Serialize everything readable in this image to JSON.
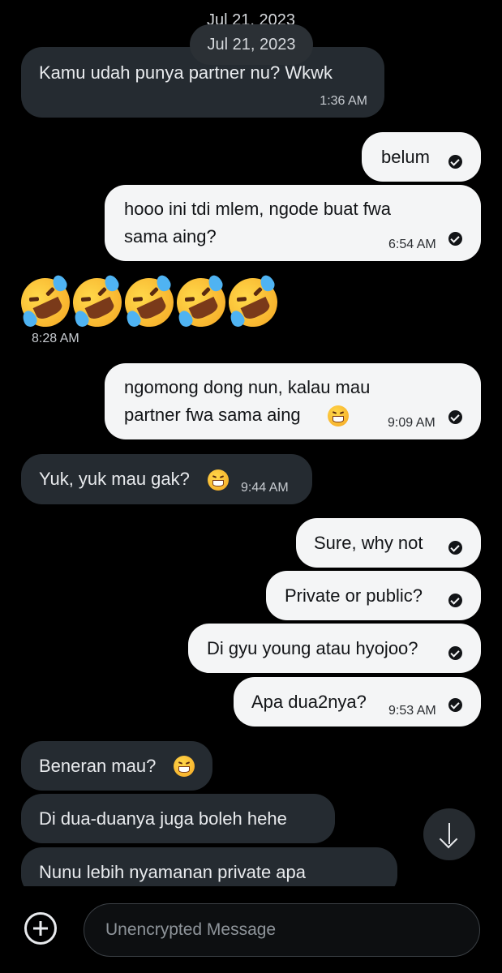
{
  "header": {
    "sticky_date": "Jul 21, 2023",
    "date_pill": "Jul 21, 2023"
  },
  "messages": [
    {
      "dir": "in",
      "lines": [
        "Kamu udah punya partner nu? Wkwk"
      ],
      "time": "1:36 AM"
    },
    {
      "dir": "out",
      "lines": [
        "belum"
      ],
      "time": ""
    },
    {
      "dir": "out",
      "lines": [
        "hooo ini tdi mlem, ngode buat fwa",
        "sama aing?"
      ],
      "time": "6:54 AM"
    },
    {
      "dir": "in",
      "emoji_only": [
        "rolling-on-floor-laughing",
        "rolling-on-floor-laughing",
        "rolling-on-floor-laughing",
        "rolling-on-floor-laughing",
        "rolling-on-floor-laughing"
      ],
      "time": "8:28 AM"
    },
    {
      "dir": "out",
      "lines": [
        "ngomong dong nun, kalau mau",
        "partner fwa sama aing"
      ],
      "emoji": "grinning-face",
      "time": "9:09 AM"
    },
    {
      "dir": "in",
      "lines": [
        "Yuk, yuk mau gak?"
      ],
      "emoji": "laughing-squint-face",
      "time": "9:44 AM"
    },
    {
      "dir": "out",
      "lines": [
        "Sure, why not"
      ],
      "time": ""
    },
    {
      "dir": "out",
      "lines": [
        "Private or public?"
      ],
      "time": ""
    },
    {
      "dir": "out",
      "lines": [
        "Di gyu young atau hyojoo?"
      ],
      "time": ""
    },
    {
      "dir": "out",
      "lines": [
        "Apa dua2nya?"
      ],
      "time": "9:53 AM"
    },
    {
      "dir": "in",
      "lines": [
        "Beneran mau?"
      ],
      "emoji": "grinning-sweat-face",
      "time": ""
    },
    {
      "dir": "in",
      "lines": [
        "Di dua-duanya juga boleh hehe"
      ],
      "time": ""
    },
    {
      "dir": "in",
      "lines": [
        "Nunu lebih nyamanan private apa"
      ],
      "time": ""
    }
  ],
  "composer": {
    "placeholder": "Unencrypted Message",
    "attach_icon": "plus-circle-icon"
  },
  "scroll_button": {
    "icon": "arrow-down-icon"
  }
}
